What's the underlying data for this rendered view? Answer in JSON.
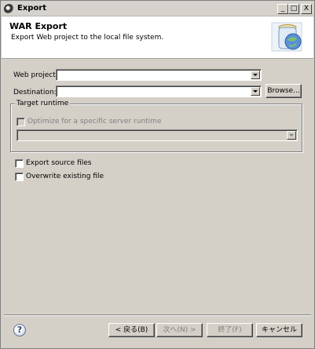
{
  "window": {
    "title": "Export"
  },
  "titlebar_buttons": {
    "minimize": "_",
    "maximize": "□",
    "close": "X"
  },
  "banner": {
    "title": "WAR Export",
    "description": "Export Web project to the local file system.",
    "icon": "jar-globe-wizard-icon"
  },
  "form": {
    "web_project_label": "Web project:",
    "web_project_value": "",
    "destination_label": "Destination:",
    "destination_value": "",
    "browse_label": "Browse...",
    "target_runtime": {
      "title": "Target runtime",
      "optimize_label": "Optimize for a specific server runtime",
      "optimize_checked": false,
      "runtime_value": ""
    },
    "export_source_label": "Export source files",
    "export_source_checked": false,
    "overwrite_label": "Overwrite existing file",
    "overwrite_checked": false
  },
  "footer": {
    "help_icon": "help-icon",
    "back_label": "< 戻る(B)",
    "next_label": "次へ(N) >",
    "finish_label": "終了(F)",
    "cancel_label": "キャンセル"
  }
}
